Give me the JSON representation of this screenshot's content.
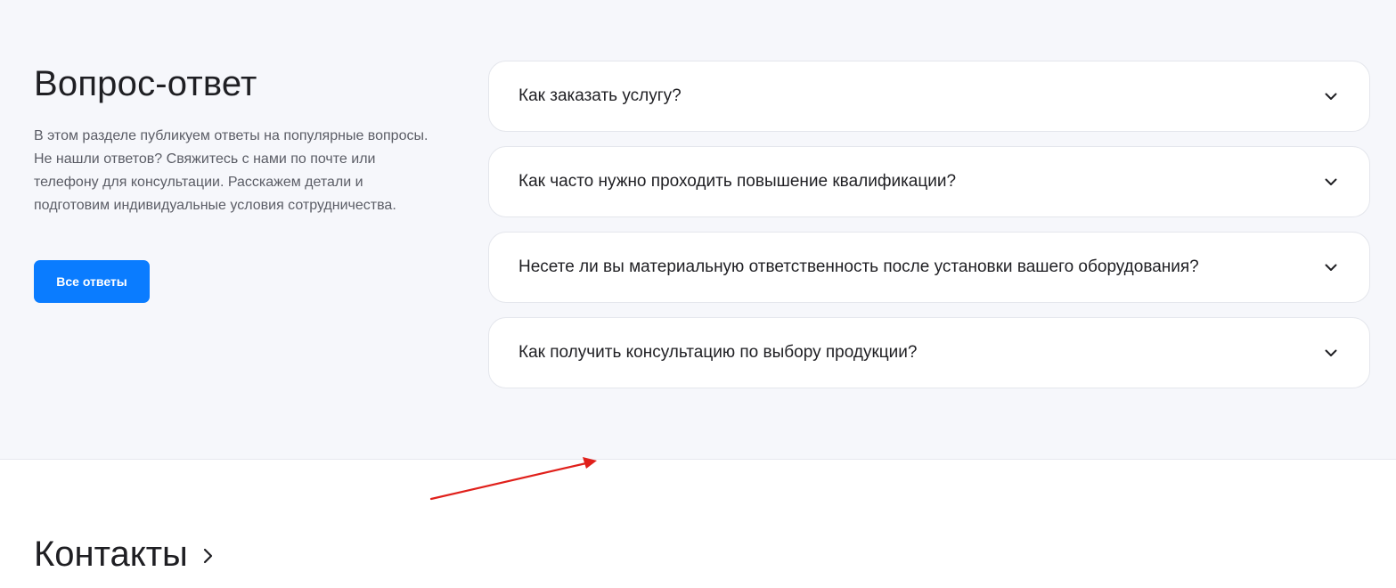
{
  "faq": {
    "title": "Вопрос-ответ",
    "description": "В этом разделе публикуем ответы на популярные вопросы. Не нашли ответов? Свяжитесь с нами по почте или телефону для консультации. Расскажем детали и подготовим индивидуальные условия сотрудничества.",
    "all_answers_label": "Все ответы",
    "items": [
      {
        "question": "Как заказать услугу?",
        "icon": "chevron-down-icon"
      },
      {
        "question": "Как часто нужно проходить повышение квалификации?",
        "icon": "chevron-down-icon"
      },
      {
        "question": "Несете ли вы материальную ответственность после установки вашего оборудования?",
        "icon": "chevron-down-icon"
      },
      {
        "question": "Как получить консультацию по выбору продукции?",
        "icon": "chevron-down-icon"
      }
    ]
  },
  "contacts": {
    "title": "Контакты",
    "icon": "chevron-right-icon"
  },
  "colors": {
    "section_bg": "#f6f7fb",
    "accent": "#0a7cff",
    "annotation": "#e0201b"
  }
}
